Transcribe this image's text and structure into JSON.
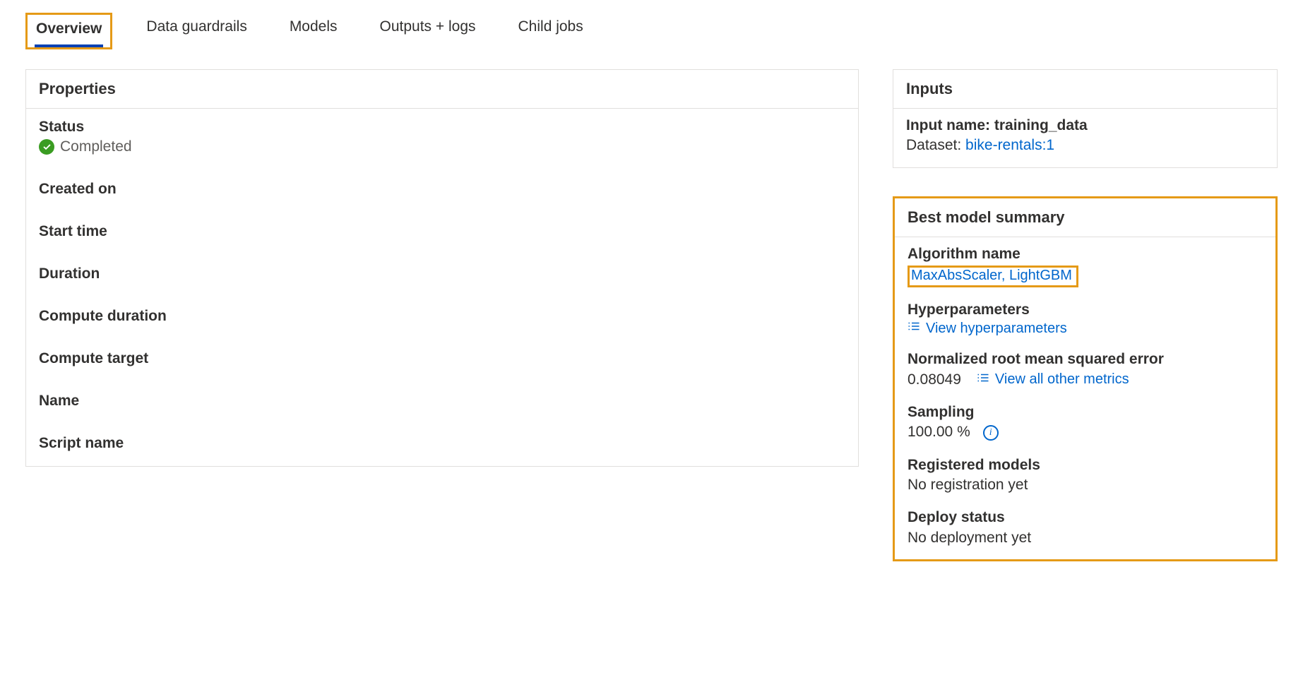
{
  "tabs": {
    "overview": "Overview",
    "guardrails": "Data guardrails",
    "models": "Models",
    "outputs": "Outputs + logs",
    "childjobs": "Child jobs"
  },
  "properties": {
    "title": "Properties",
    "statusLabel": "Status",
    "statusValue": "Completed",
    "createdOnLabel": "Created on",
    "startTimeLabel": "Start time",
    "durationLabel": "Duration",
    "computeDurationLabel": "Compute duration",
    "computeTargetLabel": "Compute target",
    "nameLabel": "Name",
    "scriptNameLabel": "Script name"
  },
  "inputs": {
    "title": "Inputs",
    "inputNameLabel": "Input name: ",
    "inputNameValue": "training_data",
    "datasetLabel": "Dataset: ",
    "datasetValue": "bike-rentals:1"
  },
  "bestModel": {
    "title": "Best model summary",
    "algorithmLabel": "Algorithm name",
    "algorithmValue": "MaxAbsScaler, LightGBM",
    "hyperLabel": "Hyperparameters",
    "hyperLink": "View hyperparameters",
    "nrmseLabel": "Normalized root mean squared error",
    "nrmseValue": "0.08049",
    "metricsLink": "View all other metrics",
    "samplingLabel": "Sampling",
    "samplingValue": "100.00 %",
    "registeredLabel": "Registered models",
    "registeredValue": "No registration yet",
    "deployLabel": "Deploy status",
    "deployValue": "No deployment yet"
  }
}
